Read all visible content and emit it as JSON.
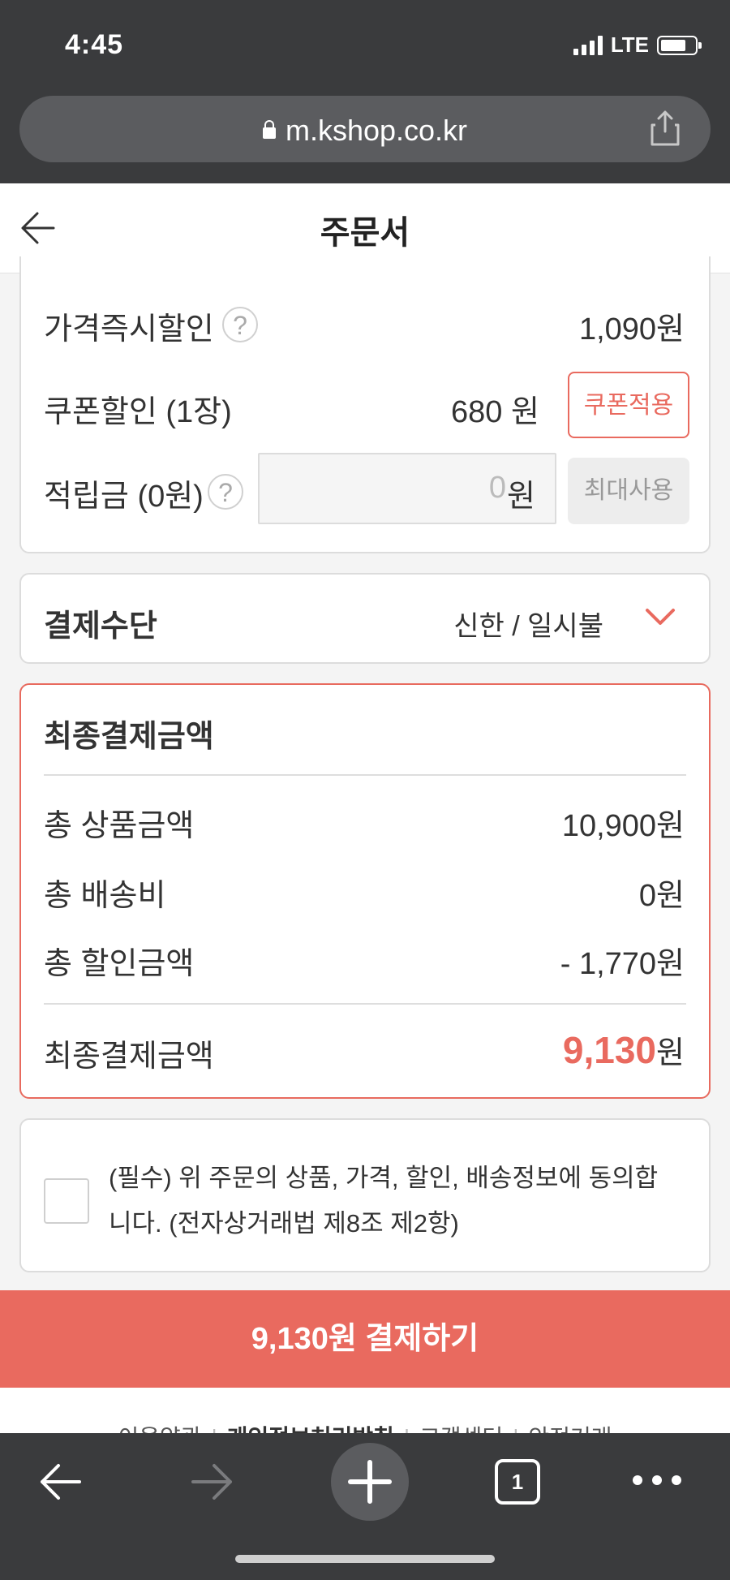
{
  "status_bar": {
    "time": "4:45",
    "network": "LTE"
  },
  "browser": {
    "url": "m.kshop.co.kr"
  },
  "header": {
    "title": "주문서"
  },
  "discounts": {
    "instant_label": "가격즉시할인",
    "instant_value": "1,090원",
    "coupon_label": "쿠폰할인 (1장)",
    "coupon_value": "680 원",
    "coupon_button": "쿠폰적용",
    "points_label": "적립금 (0원)",
    "points_input_value": "0",
    "points_unit": "원",
    "points_button": "최대사용",
    "help_glyph": "?"
  },
  "payment_method": {
    "label": "결제수단",
    "value": "신한 / 일시불"
  },
  "final_payment": {
    "heading": "최종결제금액",
    "rows": [
      {
        "label": "총 상품금액",
        "value": "10,900원"
      },
      {
        "label": "총 배송비",
        "value": "0원"
      },
      {
        "label": "총 할인금액",
        "value": "- 1,770원"
      }
    ],
    "total_label": "최종결제금액",
    "total_amount": "9,130",
    "total_unit": "원"
  },
  "agreement": {
    "text": "(필수) 위 주문의 상품, 가격, 할인, 배송정보에 동의합니다. (전자상거래법 제8조 제2항)",
    "checked": false
  },
  "pay_button": {
    "label": "9,130원 결제하기"
  },
  "footer_links": [
    "이용약관",
    "개인정보처리방침",
    "고객센터",
    "안전거래"
  ],
  "toolbar": {
    "tab_count": "1"
  },
  "colors": {
    "accent": "#e96a5f",
    "chrome": "#3a3b3d"
  }
}
